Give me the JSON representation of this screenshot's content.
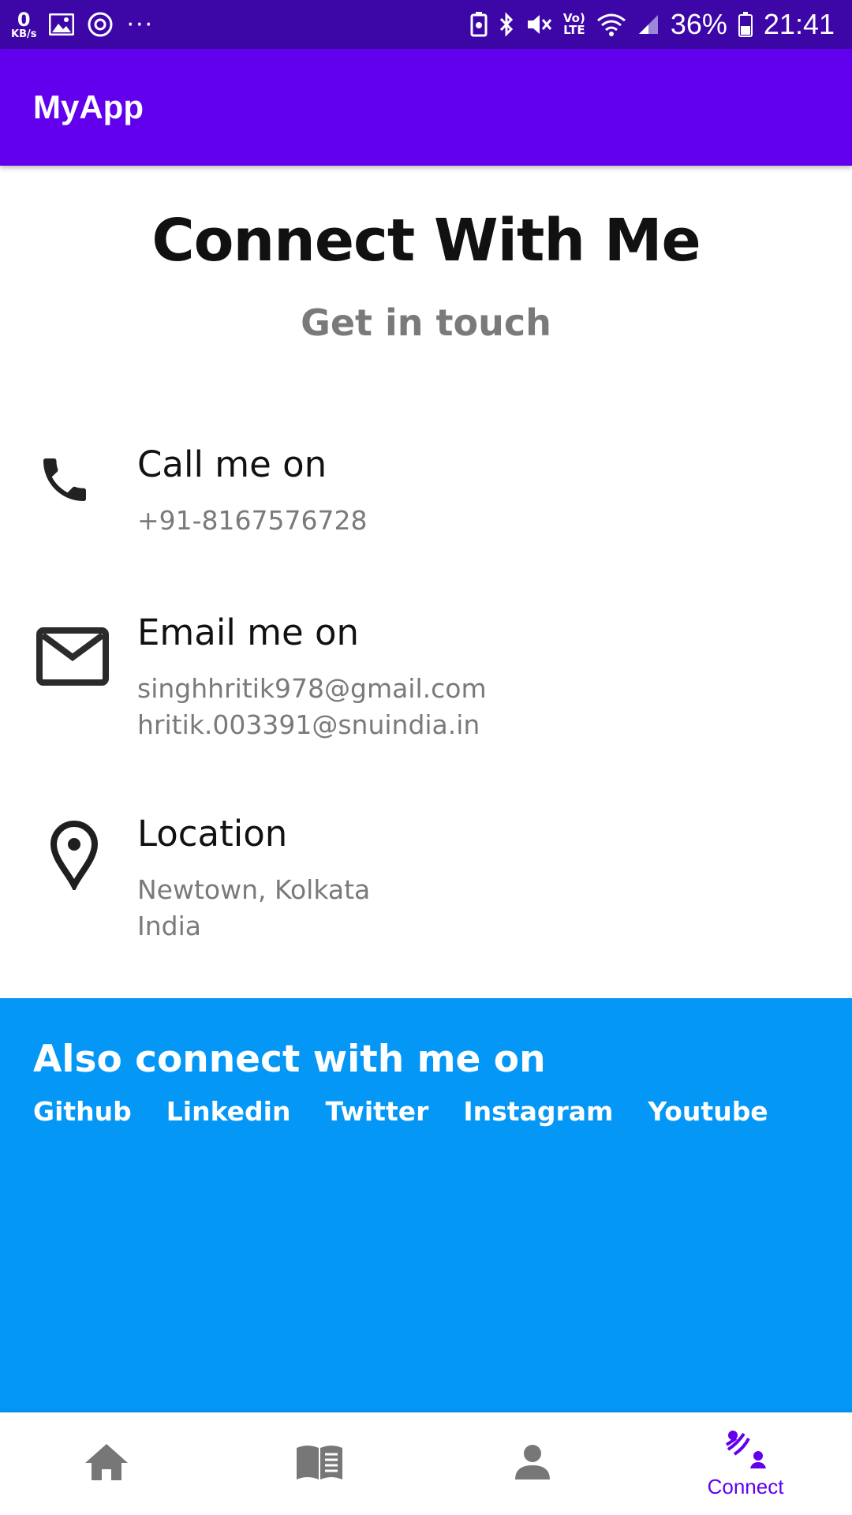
{
  "status_bar": {
    "net_speed_value": "0",
    "net_speed_unit": "KB/s",
    "more_notifications": "···",
    "volte": "Vo)",
    "lte": "LTE",
    "battery": "36%",
    "time": "21:41"
  },
  "app_bar": {
    "title": "MyApp"
  },
  "main": {
    "title": "Connect With Me",
    "subtitle": "Get in touch",
    "contacts": [
      {
        "icon": "phone-icon",
        "heading": "Call me on",
        "lines": [
          "+91-8167576728"
        ]
      },
      {
        "icon": "mail-icon",
        "heading": "Email me on",
        "lines": [
          "singhhritik978@gmail.com",
          "hritik.003391@snuindia.in"
        ]
      },
      {
        "icon": "location-pin-icon",
        "heading": "Location",
        "lines": [
          "Newtown, Kolkata",
          "India"
        ]
      }
    ]
  },
  "social": {
    "heading": "Also connect with me on",
    "links": [
      "Github",
      "Linkedin",
      "Twitter",
      "Instagram",
      "Youtube"
    ]
  },
  "bottom_nav": {
    "items": [
      {
        "icon": "home-icon",
        "label": ""
      },
      {
        "icon": "book-icon",
        "label": ""
      },
      {
        "icon": "person-icon",
        "label": ""
      },
      {
        "icon": "connect-icon",
        "label": "Connect",
        "active": true
      }
    ]
  },
  "colors": {
    "status_bar": "#3d07a8",
    "app_bar": "#6200ee",
    "social_bg": "#0597f6",
    "nav_active": "#6200ee",
    "nav_inactive": "#757575",
    "subtext": "#7a7a7a"
  }
}
